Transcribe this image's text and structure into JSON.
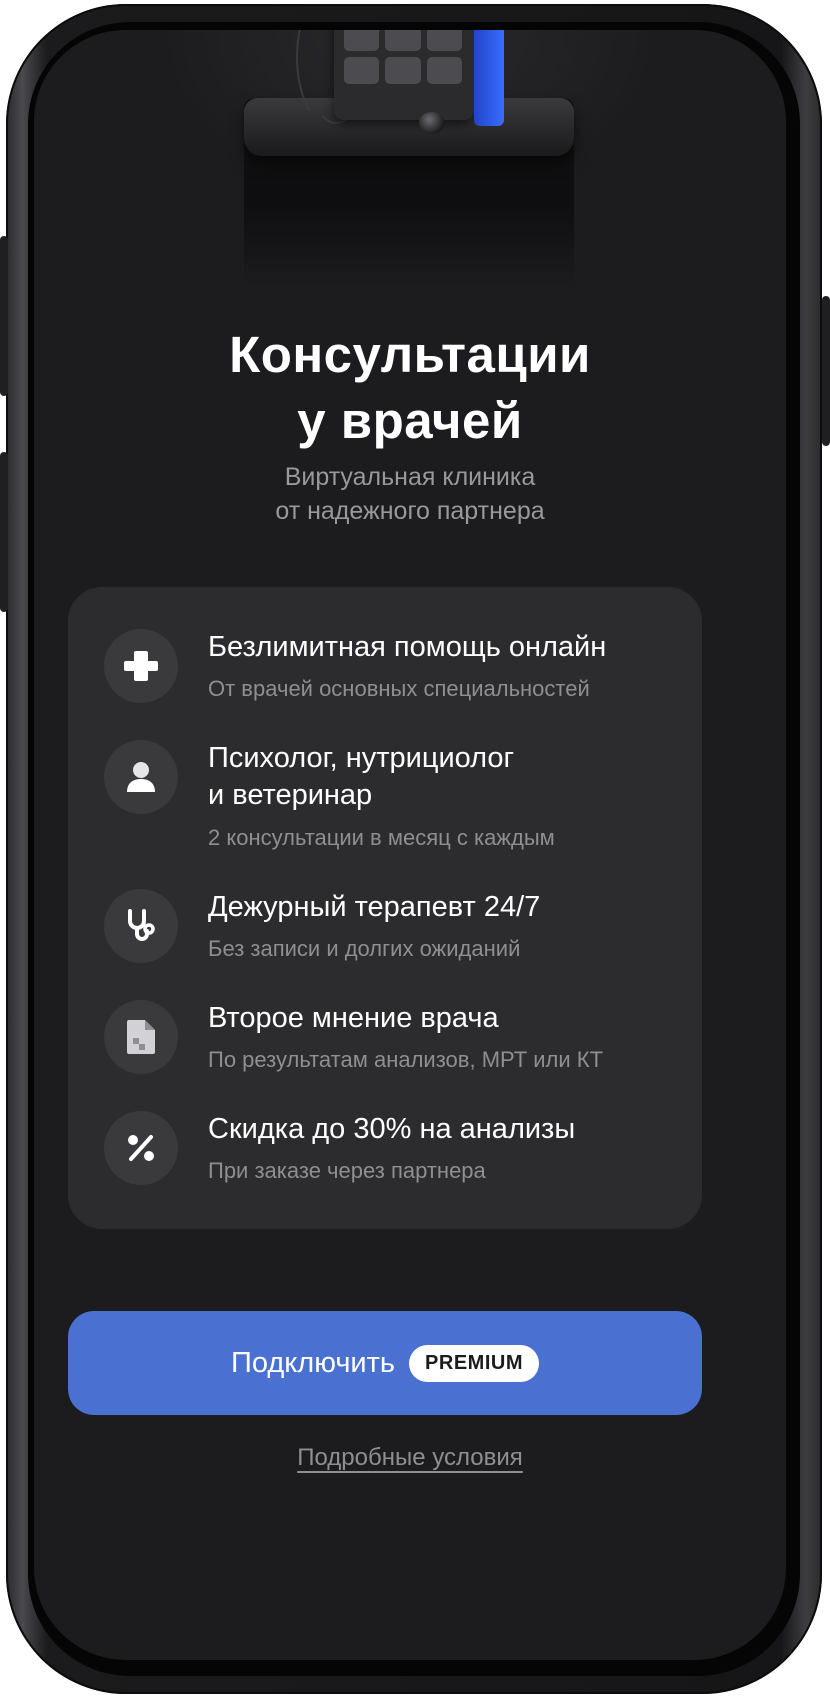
{
  "hero": {
    "title_line1": "Консультации",
    "title_line2": "у врачей",
    "subtitle_line1": "Виртуальная клиника",
    "subtitle_line2": "от надежного партнера"
  },
  "features": [
    {
      "icon": "medical-cross-icon",
      "title_lines": [
        "Безлимитная помощь онлайн"
      ],
      "subtitle": "От врачей основных специальностей"
    },
    {
      "icon": "person-icon",
      "title_lines": [
        "Психолог, нутрициолог",
        "и ветеринар"
      ],
      "subtitle": "2 консультации в месяц с каждым"
    },
    {
      "icon": "stethoscope-icon",
      "title_lines": [
        "Дежурный терапевт 24/7"
      ],
      "subtitle": "Без записи и долгих ожиданий"
    },
    {
      "icon": "document-icon",
      "title_lines": [
        "Второе мнение врача"
      ],
      "subtitle": "По результатам анализов, МРТ или КТ"
    },
    {
      "icon": "percent-icon",
      "title_lines": [
        "Скидка до 30% на анализы"
      ],
      "subtitle": "При заказе через партнера"
    }
  ],
  "cta": {
    "label": "Подключить",
    "badge": "PREMIUM"
  },
  "terms_link": "Подробные условия",
  "colors": {
    "background": "#1c1c1e",
    "card": "#2c2c2e",
    "icon_circle": "#3a3a3c",
    "accent": "#4a71d1",
    "device_accent": "#2f5de8",
    "secondary_text": "#8e8e93"
  }
}
